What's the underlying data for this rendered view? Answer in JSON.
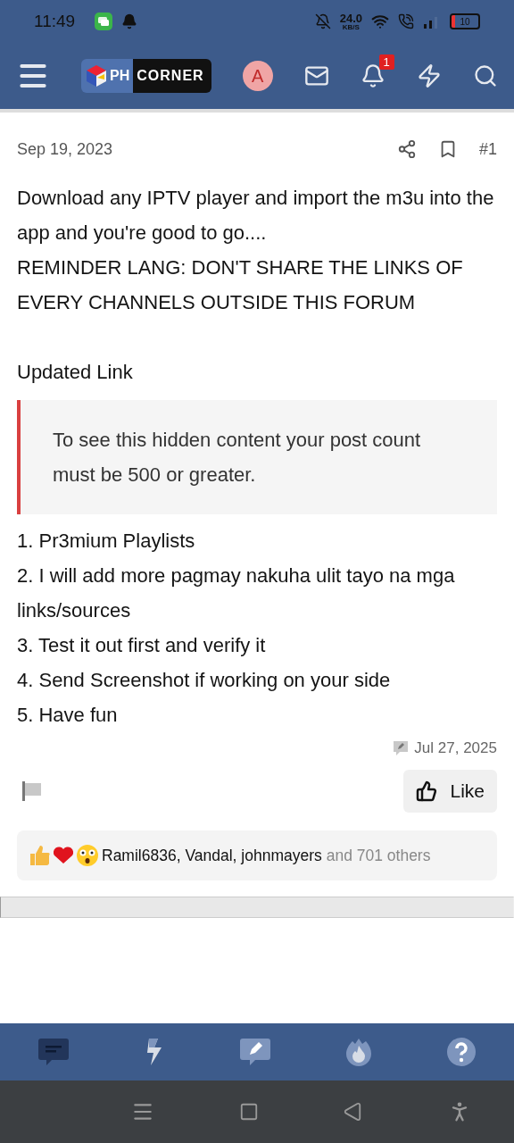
{
  "status_bar": {
    "time": "11:49",
    "speed": "24.0",
    "speed_unit": "KB/S",
    "battery": "10"
  },
  "header": {
    "logo": {
      "left": "PH",
      "right": "CORNER"
    },
    "avatar": "A",
    "notification_count": "1"
  },
  "post": {
    "date": "Sep 19, 2023",
    "number": "#1",
    "paragraphs": [
      "Download any IPTV player and import the m3u into the app and you're good to go....",
      "REMINDER LANG: DON'T SHARE THE LINKS OF EVERY CHANNELS OUTSIDE THIS FORUM"
    ],
    "subheading": "Updated Link",
    "hidden_notice": "To see this hidden content your post count must be 500 or greater.",
    "list": [
      "1. Pr3mium Playlists",
      "2. I will add more pagmay nakuha ulit tayo na mga links/sources",
      "3. Test it out first and verify it",
      "4. Send Screenshot if working on your side",
      "5. Have fun"
    ],
    "edited": "Jul 27, 2025",
    "like_button": "Like",
    "reactions": {
      "parts": [
        {
          "kind": "name",
          "text": "Ramil6836,"
        },
        {
          "kind": "name",
          "text": "Vandal,"
        },
        {
          "kind": "name",
          "text": "johnmayers"
        }
      ],
      "others": "and 701 others"
    }
  },
  "bottom_nav": [
    {
      "kind": "chat",
      "selected": true
    },
    {
      "kind": "bolt",
      "selected": false
    },
    {
      "kind": "compose",
      "selected": false
    },
    {
      "kind": "fire",
      "selected": false
    },
    {
      "kind": "help",
      "selected": false
    }
  ]
}
